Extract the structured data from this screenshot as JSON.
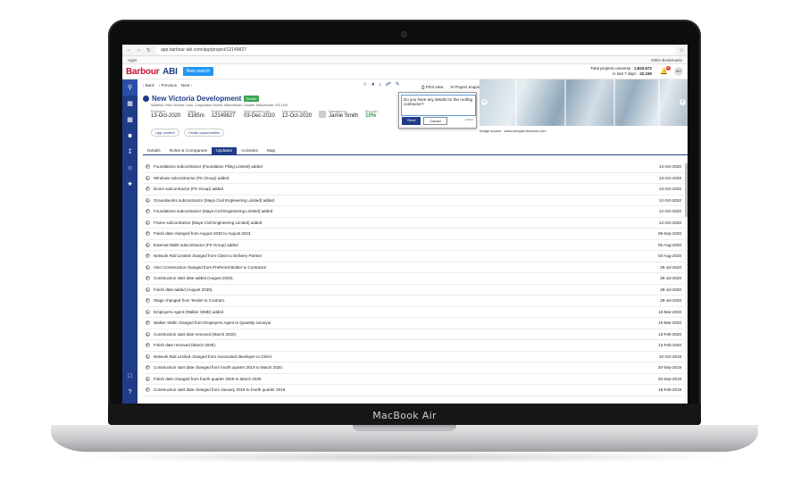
{
  "device": {
    "brand": "MacBook Air"
  },
  "browser": {
    "url": "app.barbour-abi.com/app/project/12149827",
    "bookmarks_left": "Apps",
    "bookmarks_right": "Other Bookmarks"
  },
  "header": {
    "logo_left": "Barbour",
    "logo_right": "ABI",
    "new_search": "New search",
    "totals_universe_label": "Total projects universe :",
    "totals_universe_value": "1,843,672",
    "totals_recent_label": "in last 7 days :",
    "totals_recent_value": "42,155",
    "notifications": "4",
    "user_initials": "MY"
  },
  "toolbar": {
    "back": "Back",
    "previous": "Previous",
    "next": "Next"
  },
  "project": {
    "name": "New Victoria Development",
    "badge": "Tender",
    "address_label": "Address:",
    "address": "New Victoria Land, Corporation Street, Manchester, Greater Manchester, M3 1NX",
    "published_label": "Published:",
    "published": "13-Oct-2020",
    "value_label": "Value:",
    "value": "£185m",
    "reference_label": "Project reference:",
    "reference": "12149827",
    "next_call_label": "Next research call:",
    "next_call": "03-Dec-2020",
    "last_call_label": "Last research call:",
    "last_call": "12-Oct-2020",
    "managed_label": "Managed by:",
    "managed_by": "Jamie Smith",
    "bid_label": "Bid prob.:",
    "bid": "10%",
    "opp_upp": "Upp content",
    "opp_onsite": "Onsite opportunities",
    "tag_count": "2"
  },
  "print": {
    "print_view": "Print view",
    "enquiry": "Project enquiry"
  },
  "popover": {
    "question": "Do you have any details for the roofing contractor?",
    "limit": "0/4000",
    "send": "Send",
    "cancel": "Cancel"
  },
  "image": {
    "caption": "Image source : www.shepperdrobson.com"
  },
  "tabs": [
    "Details",
    "Roles & Companies",
    "Updates",
    "Activities",
    "Map"
  ],
  "active_tab": 2,
  "updates": [
    {
      "text": "Foundations subcontractor (Foundation Piling Limited) added",
      "date": "13-Oct-2020"
    },
    {
      "text": "Windows subcontractor (FK Group) added",
      "date": "13-Oct-2020"
    },
    {
      "text": "Doors subcontractor (FK Group) added",
      "date": "13-Oct-2020"
    },
    {
      "text": "Groundworks subcontractor (Maya Civil Engineering Limited) added",
      "date": "12-Oct-2020"
    },
    {
      "text": "Foundations subcontractor (Maya Civil Engineering Limited) added",
      "date": "12-Oct-2020"
    },
    {
      "text": "Frame subcontractor (Maya Civil Engineering Limited) added",
      "date": "12-Oct-2020"
    },
    {
      "text": "Finish date changed from August 2030 to August 2023.",
      "date": "09-Sep-2020"
    },
    {
      "text": "External Walls subcontractor (FK Group) added",
      "date": "06-Aug-2020"
    },
    {
      "text": "Network Rail Limited changed from Client to Delivery Partner",
      "date": "03-Aug-2020"
    },
    {
      "text": "Vinci Construction changed from Preferred Bidder to Contractor",
      "date": "29-Jul-2020"
    },
    {
      "text": "Construction start date added (August 2020).",
      "date": "29-Jul-2020"
    },
    {
      "text": "Finish date added (August 2030).",
      "date": "29-Jul-2020"
    },
    {
      "text": "Stage changed from Tender to Contract.",
      "date": "29-Jul-2020"
    },
    {
      "text": "Employers Agent (Walker SIME) added",
      "date": "10-Mar-2020"
    },
    {
      "text": "Walker SIME changed from Employers Agent to Quantity surveyor",
      "date": "10-Mar-2020"
    },
    {
      "text": "Construction start date removed (March 2020).",
      "date": "13-Feb-2020"
    },
    {
      "text": "Finish date removed (March 2030).",
      "date": "13-Feb-2020"
    },
    {
      "text": "Network Rail Limited changed from Associated developer to Client",
      "date": "10-Oct-2019"
    },
    {
      "text": "Construction start date changed from fourth quarter 2019 to March 2020.",
      "date": "20-Sep-2019"
    },
    {
      "text": "Finish date changed from fourth quarter 2029 to March 2030.",
      "date": "20-Sep-2019"
    },
    {
      "text": "Construction start date changed from January 2019 to fourth quarter 2019.",
      "date": "18-Feb-2019"
    }
  ]
}
